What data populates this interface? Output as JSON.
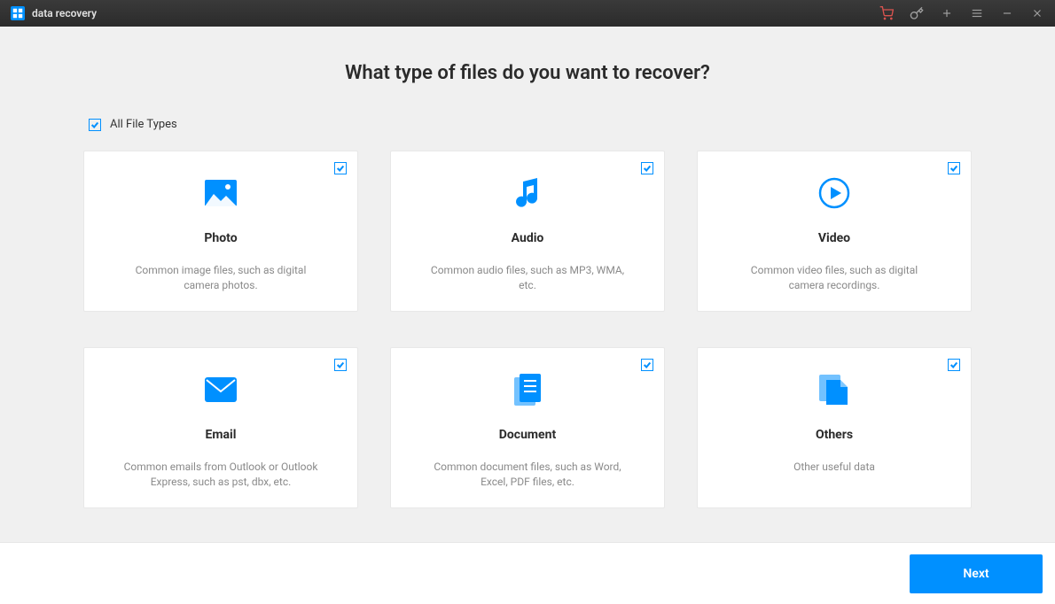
{
  "app": {
    "name": "data recovery"
  },
  "main": {
    "heading": "What type of files do you want to recover?",
    "allTypesLabel": "All File Types",
    "allTypesChecked": true
  },
  "cards": [
    {
      "id": "photo",
      "title": "Photo",
      "desc": "Common image files, such as digital camera photos.",
      "checked": true
    },
    {
      "id": "audio",
      "title": "Audio",
      "desc": "Common audio files, such as MP3, WMA, etc.",
      "checked": true
    },
    {
      "id": "video",
      "title": "Video",
      "desc": "Common video files, such as digital camera recordings.",
      "checked": true
    },
    {
      "id": "email",
      "title": "Email",
      "desc": "Common emails from Outlook or Outlook Express, such as pst, dbx, etc.",
      "checked": true
    },
    {
      "id": "document",
      "title": "Document",
      "desc": "Common document files, such as Word, Excel, PDF files, etc.",
      "checked": true
    },
    {
      "id": "others",
      "title": "Others",
      "desc": "Other useful data",
      "checked": true
    }
  ],
  "footer": {
    "nextLabel": "Next"
  },
  "colors": {
    "accent": "#0090ff"
  }
}
